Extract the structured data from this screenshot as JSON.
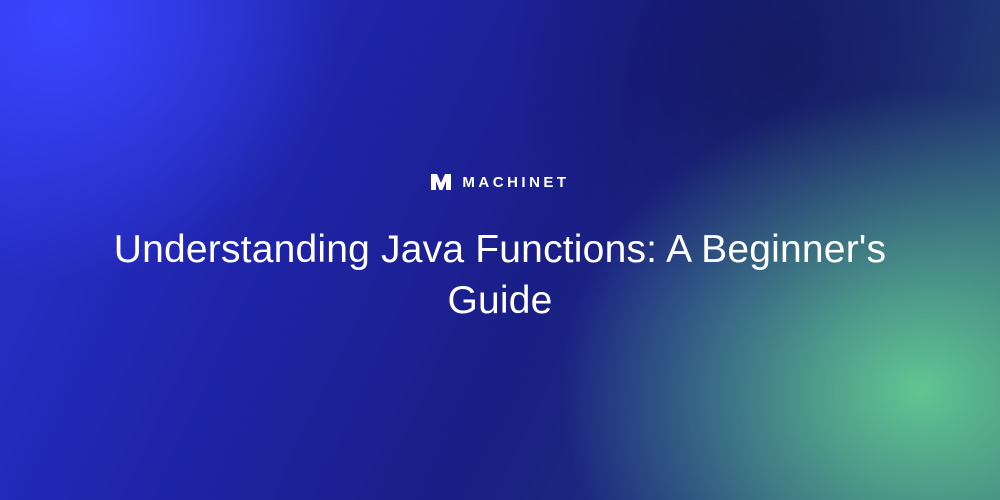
{
  "brand": {
    "name": "MACHINET",
    "icon": "machinet-logo"
  },
  "title": "Understanding Java Functions: A Beginner's Guide",
  "colors": {
    "text": "#ffffff",
    "bg_blue_bright": "#3a46ff",
    "bg_blue_mid": "#1f24a9",
    "bg_blue_deep": "#1a1e85",
    "bg_green": "#69d796"
  }
}
